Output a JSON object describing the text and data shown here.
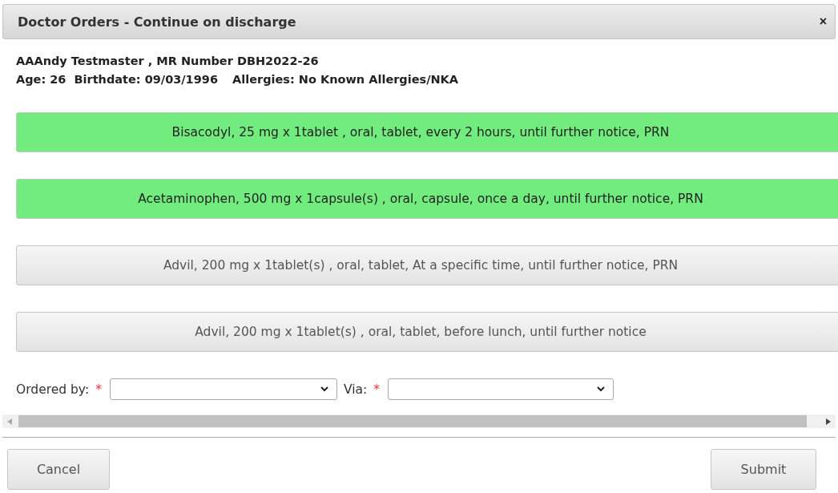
{
  "window": {
    "title": "Doctor Orders - Continue on discharge",
    "close": "×"
  },
  "patient": {
    "line_1": "AAAndy Testmaster , MR Number DBH2022-26",
    "line_2": [
      {
        "text": "Age: 26"
      },
      {
        "text": "Birthdate: 09/03/1996"
      },
      {
        "text": "Allergies: No Known Allergies/NKA"
      }
    ]
  },
  "orders": [
    {
      "label": "Bisacodyl, 25 mg x 1tablet , oral, tablet, every 2 hours, until further notice, PRN",
      "selected": true
    },
    {
      "label": "Acetaminophen, 500 mg x 1capsule(s) , oral, capsule, once a day, until further notice, PRN",
      "selected": true
    },
    {
      "label": "Advil, 200 mg x 1tablet(s) , oral, tablet, At a specific time, until further notice, PRN",
      "selected": false
    },
    {
      "label": "Advil, 200 mg x 1tablet(s) , oral, tablet, before lunch, until further notice",
      "selected": false
    }
  ],
  "fields": [
    {
      "label": "Ordered by:",
      "required_mark": "*"
    },
    {
      "label": "Via:",
      "required_mark": "*"
    }
  ],
  "buttons": [
    {
      "label": "Cancel"
    },
    {
      "label": "Submit"
    }
  ]
}
